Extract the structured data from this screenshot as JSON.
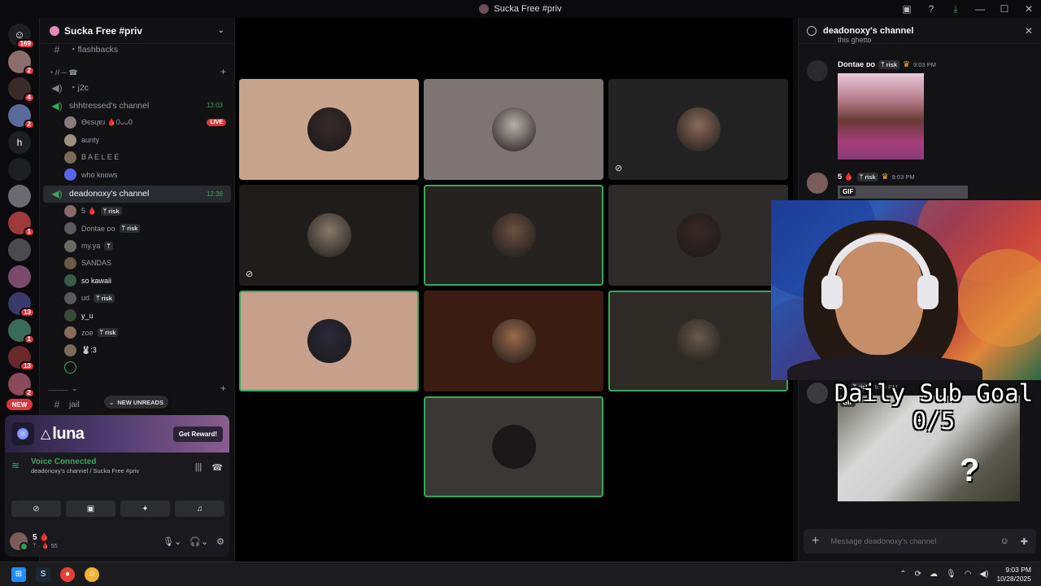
{
  "window": {
    "title": "Sucka Free #priv"
  },
  "rail": {
    "home_badge": "169",
    "servers": [
      {
        "color": "#8a6d6d",
        "badge": "2"
      },
      {
        "color": "#3a2a2a",
        "badge": "4"
      },
      {
        "color": "#5a6a9a",
        "badge": "2"
      },
      {
        "color": "#1e1f22",
        "letter": "h",
        "badge": ""
      },
      {
        "color": "#1e1f22",
        "badge": ""
      },
      {
        "color": "#6a6a70",
        "badge": ""
      },
      {
        "color": "#a03a3a",
        "badge": "1"
      },
      {
        "color": "#4a4a4f",
        "badge": ""
      },
      {
        "color": "#7a4a6a",
        "badge": ""
      },
      {
        "color": "#3a3a6a",
        "badge": "13"
      },
      {
        "color": "#3a6a5a",
        "badge": "1"
      },
      {
        "color": "#6a2a2a",
        "badge": "13"
      },
      {
        "color": "#8a4a5a",
        "badge": "2"
      }
    ],
    "new_label": "NEW"
  },
  "sidebar": {
    "guild_name": "Sucka Free #priv",
    "channels": {
      "flashbacks": "・flashbacks",
      "category1": "・// ─ ☎",
      "j2c": "・j2c",
      "ch1": {
        "name": "shhtressed's channel",
        "time": "13:03"
      },
      "ch2": {
        "name": "deadonoxy's channel",
        "time": "12:36"
      },
      "category2": "..........",
      "jail": "jail"
    },
    "ch1_users": [
      {
        "name": "Ɵєѕɥɐɹ 🩸0ᴗᴗ0",
        "live": "LIVE",
        "color": "#8a7a7a"
      },
      {
        "name": "aunty",
        "color": "#a09080"
      },
      {
        "name": "B A E L E E",
        "color": "#7a6a5a"
      },
      {
        "name": "who knows",
        "color": "#5865f2"
      }
    ],
    "ch2_users": [
      {
        "name": "5 🩸",
        "tag": "ᛘ risk",
        "color": "#8a6a6a"
      },
      {
        "name": "Dontae ᴅᴏ",
        "tag": "ᛘ risk",
        "color": "#5a5a5f"
      },
      {
        "name": "my.ya",
        "tag": "ᛘ",
        "color": "#6a6a5f"
      },
      {
        "name": "SANDAS",
        "tag": "",
        "color": "#6a5a4a"
      },
      {
        "name": "so kawaii",
        "tag": "",
        "color": "#3a5a4a"
      },
      {
        "name": "ud",
        "tag": "ᛘ risk",
        "color": "#5a5a5a"
      },
      {
        "name": "y_u",
        "tag": "",
        "color": "#3a4a3a"
      },
      {
        "name": "zoe",
        "tag": "ᛘ risk",
        "color": "#8a6a5a"
      },
      {
        "name": "🐰:3",
        "tag": "",
        "color": "#7a6a5a"
      },
      {
        "name": "",
        "tag": "",
        "color": "#1e1f22"
      }
    ],
    "new_unreads": "NEW UNREADS"
  },
  "promo": {
    "brand": "luna",
    "cta": "Get Reward!"
  },
  "voice": {
    "status": "Voice Connected",
    "location": "deadonoxy's channel / Sucka Free #priv"
  },
  "user": {
    "name": "5 🩸",
    "sub": "ᛘ · 🩸 55"
  },
  "tiles": [
    {
      "bg": "#c8a48c",
      "av": "#3a2a2a",
      "speaking": false,
      "muted": false
    },
    {
      "bg": "#7c7574",
      "av": "#b8b0a8",
      "speaking": false,
      "muted": false
    },
    {
      "bg": "#232222",
      "av": "#8a6a5a",
      "speaking": false,
      "muted": true
    },
    {
      "bg": "#1f1d1c",
      "av": "#8a7a6a",
      "speaking": false,
      "muted": true
    },
    {
      "bg": "#252220",
      "av": "#6a5040",
      "speaking": true,
      "muted": false
    },
    {
      "bg": "#2e2a29",
      "av": "#3a2826",
      "speaking": false,
      "muted": false
    },
    {
      "bg": "#c7a08b",
      "av": "#2a2a3a",
      "speaking": true,
      "muted": false
    },
    {
      "bg": "#3a1c12",
      "av": "#9a6a4a",
      "speaking": false,
      "muted": false
    },
    {
      "bg": "#2e2b26",
      "av": "#6a5a4a",
      "speaking": true,
      "muted": false
    },
    {
      "bg": "#3a3835",
      "av": "#1a1818",
      "speaking": true,
      "muted": false
    }
  ],
  "chat": {
    "title": "deadonoxy's channel",
    "truncated_text": "this ghetto",
    "messages": [
      {
        "author": "Dontae ᴅᴏ",
        "tag": "ᛘ risk",
        "crown": "♛",
        "time": "9:03 PM"
      },
      {
        "author": "5 🩸",
        "tag": "ᛘ risk",
        "crown": "♛",
        "time": "9:03 PM",
        "gif": "GIF"
      },
      {
        "author": "ud",
        "tag": "ᛘ risk",
        "time": "9:03 PM",
        "gif": "GIF"
      }
    ],
    "composer_placeholder": "Message deadonoxy's channel"
  },
  "overlay": {
    "goal_title": "Daily Sub Goal",
    "goal_value": "0/5"
  },
  "taskbar": {
    "time": "9:03 PM",
    "date": "10/28/2025"
  }
}
